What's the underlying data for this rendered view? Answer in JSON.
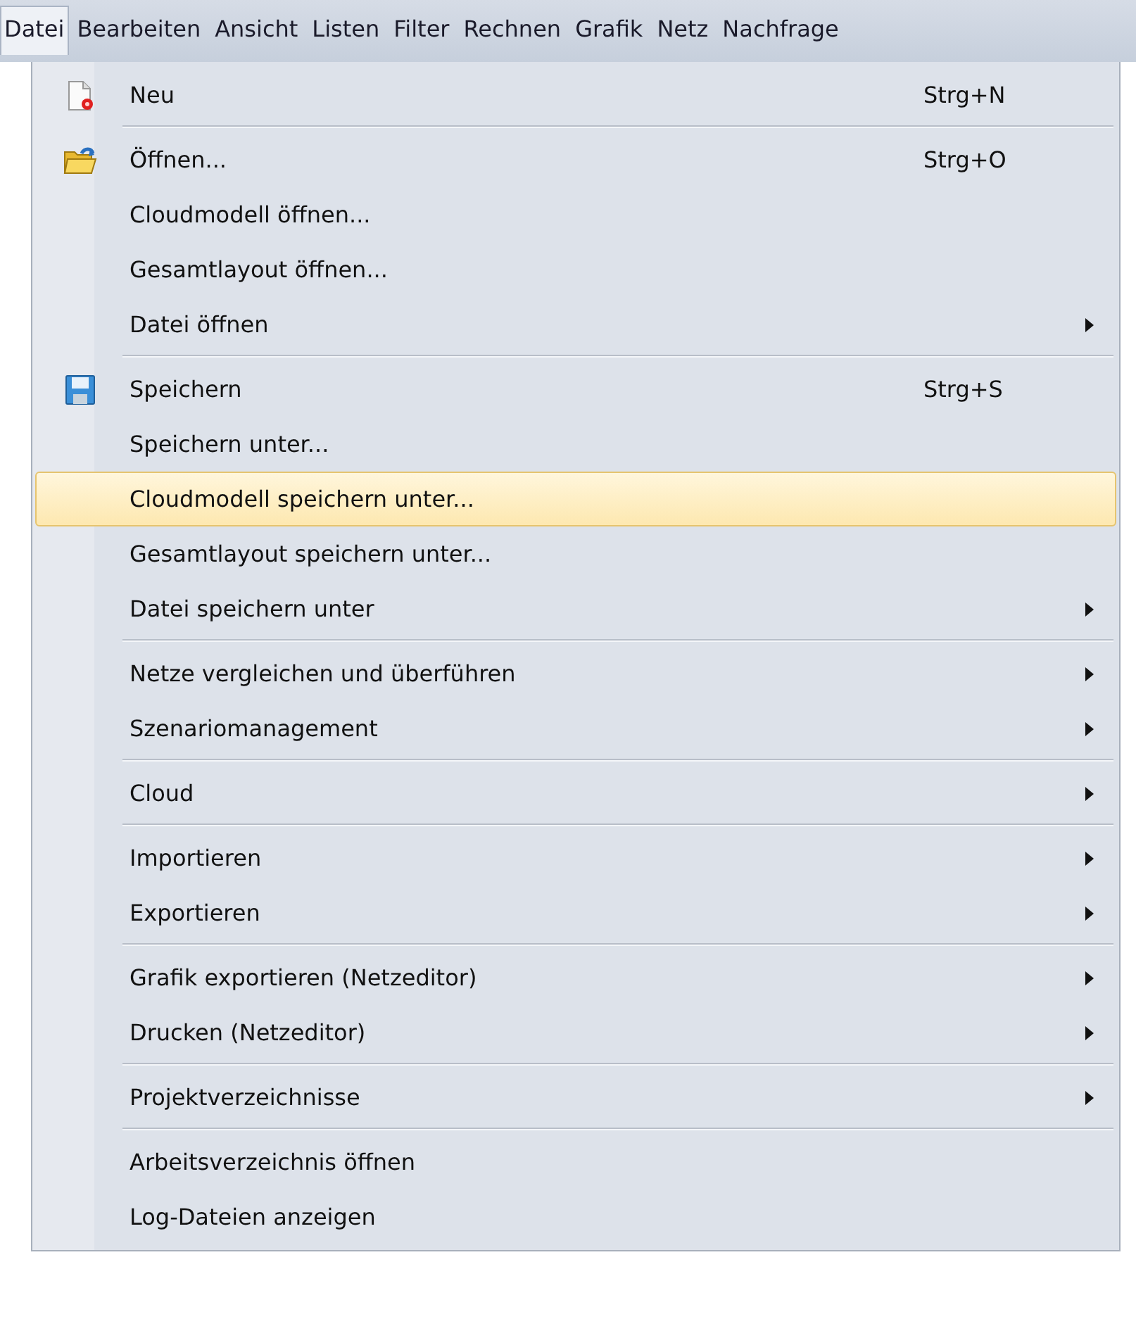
{
  "menubar": [
    {
      "label": "Datei",
      "selected": true
    },
    {
      "label": "Bearbeiten",
      "selected": false
    },
    {
      "label": "Ansicht",
      "selected": false
    },
    {
      "label": "Listen",
      "selected": false
    },
    {
      "label": "Filter",
      "selected": false
    },
    {
      "label": "Rechnen",
      "selected": false
    },
    {
      "label": "Grafik",
      "selected": false
    },
    {
      "label": "Netz",
      "selected": false
    },
    {
      "label": "Nachfrage",
      "selected": false
    }
  ],
  "menu": {
    "groups": [
      [
        {
          "label": "Neu",
          "shortcut": "Strg+N",
          "kind": "new",
          "submenu": false,
          "selected": false
        }
      ],
      [
        {
          "label": "Öffnen...",
          "shortcut": "Strg+O",
          "kind": "open",
          "submenu": false,
          "selected": false
        },
        {
          "label": "Cloudmodell öffnen...",
          "submenu": false,
          "selected": false
        },
        {
          "label": "Gesamtlayout öffnen...",
          "submenu": false,
          "selected": false
        },
        {
          "label": "Datei öffnen",
          "submenu": true,
          "selected": false
        }
      ],
      [
        {
          "label": "Speichern",
          "shortcut": "Strg+S",
          "kind": "save",
          "submenu": false,
          "selected": false
        },
        {
          "label": "Speichern unter...",
          "submenu": false,
          "selected": false
        },
        {
          "label": "Cloudmodell speichern unter...",
          "submenu": false,
          "selected": true
        },
        {
          "label": "Gesamtlayout speichern unter...",
          "submenu": false,
          "selected": false
        },
        {
          "label": "Datei speichern unter",
          "submenu": true,
          "selected": false
        }
      ],
      [
        {
          "label": "Netze vergleichen und überführen",
          "submenu": true,
          "selected": false
        },
        {
          "label": "Szenariomanagement",
          "submenu": true,
          "selected": false
        }
      ],
      [
        {
          "label": "Cloud",
          "submenu": true,
          "selected": false
        }
      ],
      [
        {
          "label": "Importieren",
          "submenu": true,
          "selected": false
        },
        {
          "label": "Exportieren",
          "submenu": true,
          "selected": false
        }
      ],
      [
        {
          "label": "Grafik exportieren (Netzeditor)",
          "submenu": true,
          "selected": false
        },
        {
          "label": "Drucken (Netzeditor)",
          "submenu": true,
          "selected": false
        }
      ],
      [
        {
          "label": "Projektverzeichnisse",
          "submenu": true,
          "selected": false
        }
      ],
      [
        {
          "label": "Arbeitsverzeichnis öffnen",
          "submenu": false,
          "selected": false
        },
        {
          "label": "Log-Dateien anzeigen",
          "submenu": false,
          "selected": false
        }
      ]
    ]
  }
}
